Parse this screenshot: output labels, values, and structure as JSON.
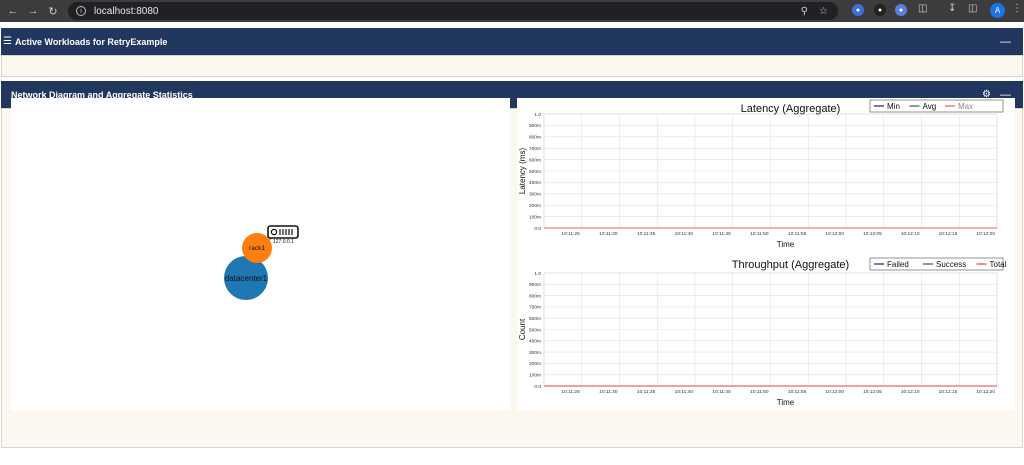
{
  "browser": {
    "url": "localhost:8080",
    "profile_initial": "A"
  },
  "workloads_panel": {
    "title": "Active Workloads for RetryExample"
  },
  "network_panel": {
    "title": "Network Diagram and Aggregate Statistics",
    "nodes": {
      "datacenter": "datacenter1",
      "rack": "rack1",
      "server_ip": "127.0.0.1"
    },
    "colors": {
      "datacenter": "#1f77b4",
      "rack": "#ff7f0e",
      "header": "#22375f"
    }
  },
  "chart_data": [
    {
      "type": "line",
      "title": "Latency (Aggregate)",
      "xlabel": "Time",
      "ylabel": "Latency (ms)",
      "ylim": [
        0,
        1.0
      ],
      "yticks": [
        "0.0",
        "100m",
        "200m",
        "300m",
        "400m",
        "500m",
        "600m",
        "700m",
        "800m",
        "900m",
        "1.0"
      ],
      "categories": [
        "10:11:25",
        "10:11:30",
        "10:11:35",
        "10:11:40",
        "10:11:45",
        "10:11:50",
        "10:11:55",
        "10:12:00",
        "10:12:05",
        "10:12:10",
        "10:12:15",
        "10:12:20"
      ],
      "series": [
        {
          "name": "Min",
          "color": "#1f1f6e",
          "values": [
            0,
            0,
            0,
            0,
            0,
            0,
            0,
            0,
            0,
            0,
            0,
            0
          ]
        },
        {
          "name": "Avg",
          "color": "#1d6b2e",
          "values": [
            0,
            0,
            0,
            0,
            0,
            0,
            0,
            0,
            0,
            0,
            0,
            0
          ]
        },
        {
          "name": "Max",
          "color": "#e06060",
          "values": [
            0,
            0,
            0,
            0,
            0,
            0,
            0,
            0,
            0,
            0,
            0,
            0
          ]
        }
      ],
      "legend": "top-right"
    },
    {
      "type": "line",
      "title": "Throughput (Aggregate)",
      "xlabel": "Time",
      "ylabel": "Count",
      "ylim": [
        0,
        1.0
      ],
      "yticks": [
        "0.0",
        "100m",
        "200m",
        "300m",
        "400m",
        "500m",
        "600m",
        "700m",
        "800m",
        "900m",
        "1.0"
      ],
      "categories": [
        "10:11:25",
        "10:11:30",
        "10:11:35",
        "10:11:40",
        "10:11:45",
        "10:11:50",
        "10:11:55",
        "10:12:00",
        "10:12:05",
        "10:12:10",
        "10:12:15",
        "10:12:20"
      ],
      "series": [
        {
          "name": "Failed",
          "color": "#1f1f6e",
          "values": [
            0,
            0,
            0,
            0,
            0,
            0,
            0,
            0,
            0,
            0,
            0,
            0
          ]
        },
        {
          "name": "Success",
          "color": "#1d6b2e",
          "values": [
            0,
            0,
            0,
            0,
            0,
            0,
            0,
            0,
            0,
            0,
            0,
            0
          ]
        },
        {
          "name": "Total",
          "color": "#e04040",
          "values": [
            0,
            0,
            0,
            0,
            0,
            0,
            0,
            0,
            0,
            0,
            0,
            0
          ]
        }
      ],
      "legend": "top-right"
    }
  ]
}
